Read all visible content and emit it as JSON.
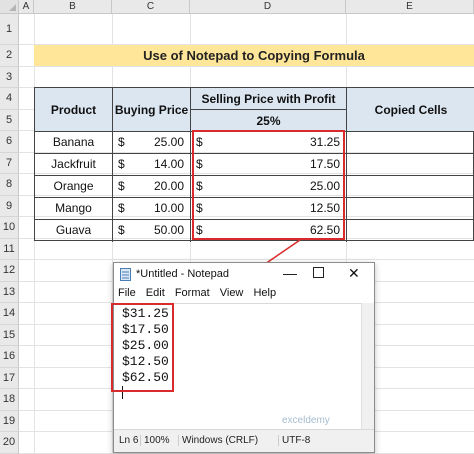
{
  "columns": [
    "A",
    "B",
    "C",
    "D",
    "E"
  ],
  "rows": [
    "1",
    "2",
    "3",
    "4",
    "5",
    "6",
    "7",
    "8",
    "9",
    "10",
    "11",
    "12",
    "13",
    "14",
    "15",
    "16",
    "17",
    "18",
    "19",
    "20"
  ],
  "title": "Use of Notepad to Copying Formula",
  "table": {
    "headers": {
      "product": "Product",
      "buying": "Buying Price",
      "selling": "Selling Price with Profit",
      "profit_pct": "25%",
      "copied": "Copied Cells"
    },
    "currency": "$",
    "rows": [
      {
        "product": "Banana",
        "buying": "25.00",
        "selling": "31.25"
      },
      {
        "product": "Jackfruit",
        "buying": "14.00",
        "selling": "17.50"
      },
      {
        "product": "Orange",
        "buying": "20.00",
        "selling": "25.00"
      },
      {
        "product": "Mango",
        "buying": "10.00",
        "selling": "12.50"
      },
      {
        "product": "Guava",
        "buying": "50.00",
        "selling": "62.50"
      }
    ]
  },
  "notepad": {
    "title": "*Untitled - Notepad",
    "menu": [
      "File",
      "Edit",
      "Format",
      "View",
      "Help"
    ],
    "lines": [
      "$31.25",
      "$17.50",
      "$25.00",
      "$12.50",
      "$62.50"
    ],
    "status": {
      "position": "Ln 6",
      "zoom": "100%",
      "eol": "Windows (CRLF)",
      "encoding": "UTF-8"
    }
  },
  "watermark": "exceldemy",
  "accent": {
    "red": "#d92b2b",
    "title_bg": "#ffe699",
    "header_bg": "#dce6f1"
  }
}
